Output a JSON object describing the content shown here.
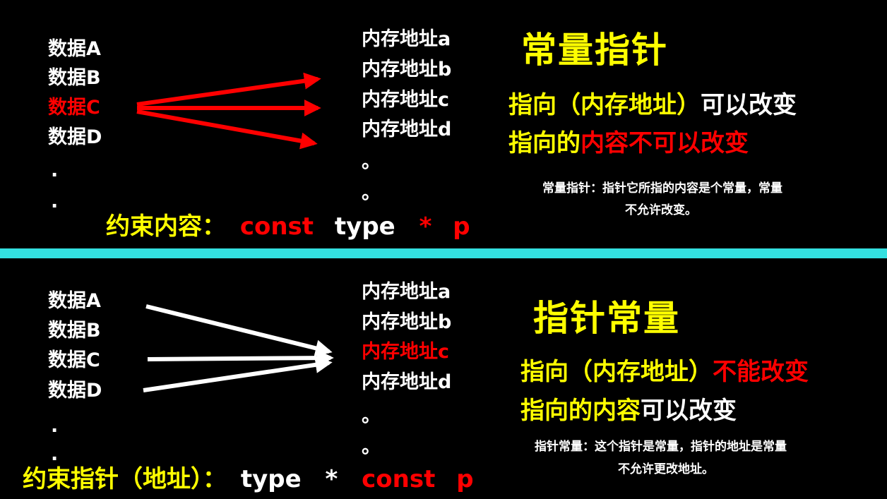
{
  "colors": {
    "background": "#000000",
    "white": "#ffffff",
    "yellow": "#ffff00",
    "red": "#ff0000",
    "divider": "#33e0e0"
  },
  "top": {
    "data_items": [
      "数据A",
      "数据B",
      "数据C",
      "数据D",
      ".",
      "."
    ],
    "highlighted_data_index": 2,
    "memory_items": [
      "内存地址a",
      "内存地址b",
      "内存地址c",
      "内存地址d",
      "。",
      "。"
    ],
    "title": "常量指针",
    "rule1": {
      "part1": "指向（内存地址）",
      "part2": "可以改变"
    },
    "rule2": {
      "part1": "指向的",
      "part2": "内容不可以改变"
    },
    "note": {
      "line1": "常量指针：指针它所指的内容是个常量，常量",
      "line2": "不允许改变。"
    },
    "constraint": {
      "label": "约束内容：",
      "kw1": "const",
      "kw2": "type",
      "kw3": "*",
      "kw4": "p"
    }
  },
  "bottom": {
    "data_items": [
      "数据A",
      "数据B",
      "数据C",
      "数据D",
      ".",
      "."
    ],
    "memory_items": [
      "内存地址a",
      "内存地址b",
      "内存地址c",
      "内存地址d",
      "。",
      "。"
    ],
    "highlighted_memory_index": 2,
    "title": "指针常量",
    "rule1": {
      "part1": "指向（内存地址）",
      "part2": "不能改变"
    },
    "rule2": {
      "part1": "指向的内容",
      "part2": "可以改变"
    },
    "note": {
      "line1": "指针常量：这个指针是常量，指针的地址是常量",
      "line2": "不允许更改地址。"
    },
    "constraint": {
      "label": "约束指针（地址）：",
      "kw1": "type",
      "kw2": "*",
      "kw3": "const",
      "kw4": "p"
    }
  }
}
